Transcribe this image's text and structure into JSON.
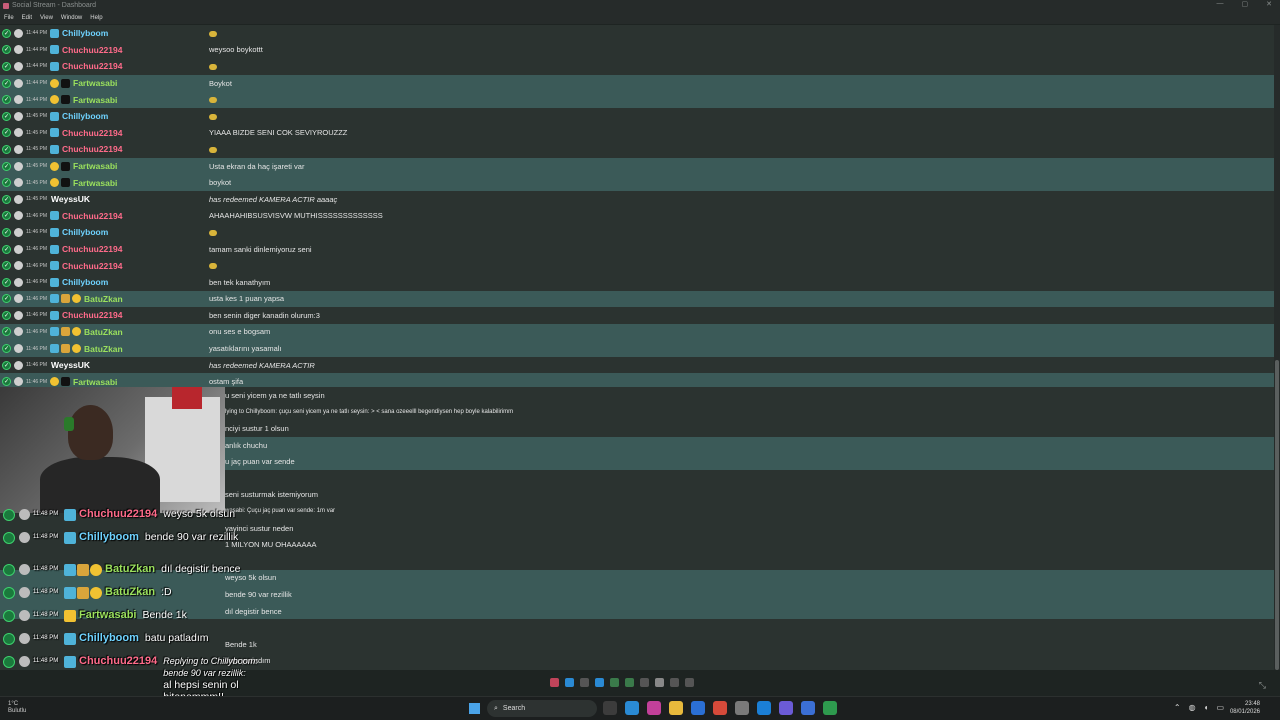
{
  "window": {
    "title": "Social Stream - Dashboard",
    "controls": [
      "—",
      "▢",
      "✕"
    ]
  },
  "menu": [
    "File",
    "Edit",
    "View",
    "Window",
    "Help"
  ],
  "colors": {
    "chillyboom": "#6fd3ff",
    "chuchuu": "#ff6b8a",
    "fartwasabi": "#9be15d",
    "batuzkan": "#9be15d",
    "weyssuk": "#ffffff",
    "row_alt": "#3b5a58",
    "row_base": "#2b3330"
  },
  "chat_rows": [
    {
      "time": "11:44 PM",
      "name": "Chillyboom",
      "color": "#6fd3ff",
      "message": "",
      "alt": false
    },
    {
      "time": "11:44 PM",
      "name": "Chuchuu22194",
      "color": "#ff6b8a",
      "message": "weysoo boykottt",
      "alt": false
    },
    {
      "time": "11:44 PM",
      "name": "Chuchuu22194",
      "color": "#ff6b8a",
      "message": "",
      "alt": false
    },
    {
      "time": "11:44 PM",
      "name": "Fartwasabi",
      "color": "#9be15d",
      "message": "Boykot",
      "alt": true
    },
    {
      "time": "11:44 PM",
      "name": "Fartwasabi",
      "color": "#9be15d",
      "message": "",
      "alt": true
    },
    {
      "time": "11:45 PM",
      "name": "Chillyboom",
      "color": "#6fd3ff",
      "message": "",
      "alt": false
    },
    {
      "time": "11:45 PM",
      "name": "Chuchuu22194",
      "color": "#ff6b8a",
      "message": "YIAAA BIZDE SENI COK SEVIYROUZZZ",
      "alt": false
    },
    {
      "time": "11:45 PM",
      "name": "Chuchuu22194",
      "color": "#ff6b8a",
      "message": "",
      "alt": false
    },
    {
      "time": "11:45 PM",
      "name": "Fartwasabi",
      "color": "#9be15d",
      "message": "Usta ekran da haç işareti var",
      "alt": true
    },
    {
      "time": "11:45 PM",
      "name": "Fartwasabi",
      "color": "#9be15d",
      "message": "boykot",
      "alt": true
    },
    {
      "time": "11:45 PM",
      "name": "WeyssUK",
      "color": "#ffffff",
      "message": "has redeemed KAMERA ACTIR aaaaç",
      "alt": false,
      "italic": true
    },
    {
      "time": "11:46 PM",
      "name": "Chuchuu22194",
      "color": "#ff6b8a",
      "message": "AHAAHAHIBSUSVISVW MUTHISSSSSSSSSSSSS",
      "alt": false
    },
    {
      "time": "11:46 PM",
      "name": "Chillyboom",
      "color": "#6fd3ff",
      "message": "",
      "alt": false
    },
    {
      "time": "11:46 PM",
      "name": "Chuchuu22194",
      "color": "#ff6b8a",
      "message": "tamam sanki dinlemiyoruz seni",
      "alt": false
    },
    {
      "time": "11:46 PM",
      "name": "Chuchuu22194",
      "color": "#ff6b8a",
      "message": "",
      "alt": false
    },
    {
      "time": "11:46 PM",
      "name": "Chillyboom",
      "color": "#6fd3ff",
      "message": "ben tek kanathyım",
      "alt": false
    },
    {
      "time": "11:46 PM",
      "name": "BatuZkan",
      "color": "#9be15d",
      "message": "usta kes 1 puan yapsa",
      "alt": true
    },
    {
      "time": "11:46 PM",
      "name": "Chuchuu22194",
      "color": "#ff6b8a",
      "message": "ben senin diger kanadin olurum:3",
      "alt": false
    },
    {
      "time": "11:46 PM",
      "name": "BatuZkan",
      "color": "#9be15d",
      "message": "onu ses e bogsam",
      "alt": true
    },
    {
      "time": "11:46 PM",
      "name": "BatuZkan",
      "color": "#9be15d",
      "message": "yasatıklarını yasamalı",
      "alt": true
    },
    {
      "time": "11:46 PM",
      "name": "WeyssUK",
      "color": "#ffffff",
      "message": "has redeemed KAMERA ACTIR",
      "alt": false,
      "italic": true
    },
    {
      "time": "11:46 PM",
      "name": "Fartwasabi",
      "color": "#9be15d",
      "message": "ostam şifa",
      "alt": true
    }
  ],
  "lower_rows": [
    {
      "message": "u seni yicem ya ne tatlı seysin",
      "alt": false,
      "small": false
    },
    {
      "message": "lying to Chillyboom: çuçu seni yicem ya ne tatlı seysin: > < sana ozeeelll begendiysen hep boyle kalabilirimm",
      "alt": false,
      "small": true
    },
    {
      "message": "nciyi sustur 1 olsun",
      "alt": false,
      "small": false
    },
    {
      "message": "anlık chuchu",
      "alt": true,
      "small": false
    },
    {
      "message": "u jaç puan var sende",
      "alt": true,
      "small": false
    },
    {
      "message": "",
      "alt": false,
      "small": false
    },
    {
      "message": "seni susturmak istemiyorum",
      "alt": false,
      "small": false
    },
    {
      "message": "wasabi: Çuçu jaç puan var sende: 1m var",
      "alt": false,
      "small": true
    },
    {
      "message": "yayinci sustur neden",
      "alt": false,
      "small": false
    },
    {
      "message": "1 MILYON MU OHAAAAAA",
      "alt": false,
      "small": false
    },
    {
      "message": "",
      "alt": false,
      "small": false
    },
    {
      "message": "weyso 5k olsun",
      "alt": true,
      "small": false
    },
    {
      "message": "bende 90 var rezillik",
      "alt": true,
      "small": false
    },
    {
      "message": "dıl degistir bence",
      "alt": true,
      "small": false
    },
    {
      "message": "",
      "alt": false,
      "small": false
    },
    {
      "message": "Bende 1k",
      "alt": false,
      "small": false
    },
    {
      "message": "batu patladım",
      "alt": false,
      "small": false
    },
    {
      "message": "lying to Chillyboom: bende 90 var rezillik: al hepsi senin ol bitanemmm!!",
      "alt": false,
      "small": true
    }
  ],
  "lower_names": [
    "BatuZkan",
    "Chillyboom",
    "Fartwasabi",
    "Chillyboom"
  ],
  "overlay": [
    {
      "time": "11:48 PM",
      "name": "Chuchuu22194",
      "color": "#ff6b8a",
      "text": "weyso 5k olsun",
      "reply": ""
    },
    {
      "time": "11:48 PM",
      "name": "Chillyboom",
      "color": "#6fd3ff",
      "text": "bende 90 var rezillik",
      "reply": ""
    },
    {
      "time": "11:48 PM",
      "name": "BatuZkan",
      "color": "#9be15d",
      "text": "dıl degistir bence",
      "reply": ""
    },
    {
      "time": "11:48 PM",
      "name": "BatuZkan",
      "color": "#9be15d",
      "text": ":D",
      "reply": ""
    },
    {
      "time": "11:48 PM",
      "name": "Fartwasabi",
      "color": "#9be15d",
      "text": "Bende 1k",
      "reply": ""
    },
    {
      "time": "11:48 PM",
      "name": "Chillyboom",
      "color": "#6fd3ff",
      "text": "batu patladım",
      "reply": ""
    },
    {
      "time": "11:48 PM",
      "name": "Chuchuu22194",
      "color": "#ff6b8a",
      "text": "al hepsi senin ol bitanemmm!!",
      "reply": "Replying to Chillyboom: bende 90 var rezillik:"
    }
  ],
  "taskbar": {
    "weather_temp": "1°C",
    "weather_desc": "Bulutlu",
    "search_placeholder": "Search",
    "time": "23:48",
    "date": "08/01/2026",
    "apps": [
      "#3c3c3c",
      "#2a8ad4",
      "#c2409a",
      "#e8b93c",
      "#2b6fd4",
      "#d64a3a",
      "#7a7a7a",
      "#1b7fd6",
      "#6b5bd6",
      "#3b6fd4",
      "#2e9a4e"
    ]
  }
}
